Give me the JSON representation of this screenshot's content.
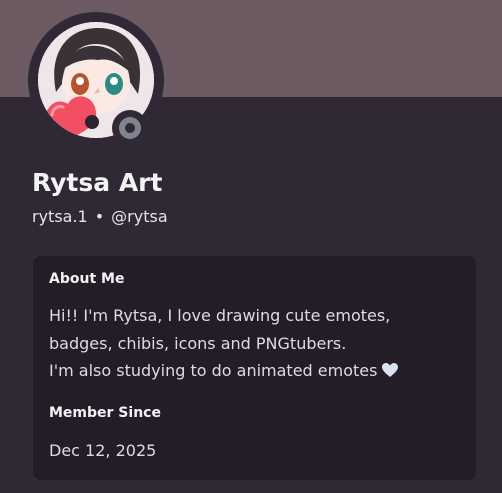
{
  "profile": {
    "display_name": "Rytsa Art",
    "username": "rytsa.1",
    "separator": "•",
    "handle": "@rytsa",
    "status": "offline"
  },
  "about": {
    "title": "About Me",
    "lines": [
      "Hi!! I'm Rytsa, I love drawing cute emotes,",
      "badges, chibis, icons and PNGtubers.",
      "I'm also studying to do animated emotes"
    ],
    "trailing_icon": "white-heart-icon"
  },
  "member": {
    "title": "Member Since",
    "date": "Dec 12, 2025"
  },
  "colors": {
    "banner": "#6b5a61",
    "card": "#302834",
    "box": "#241d27",
    "status_offline": "#80848e"
  }
}
